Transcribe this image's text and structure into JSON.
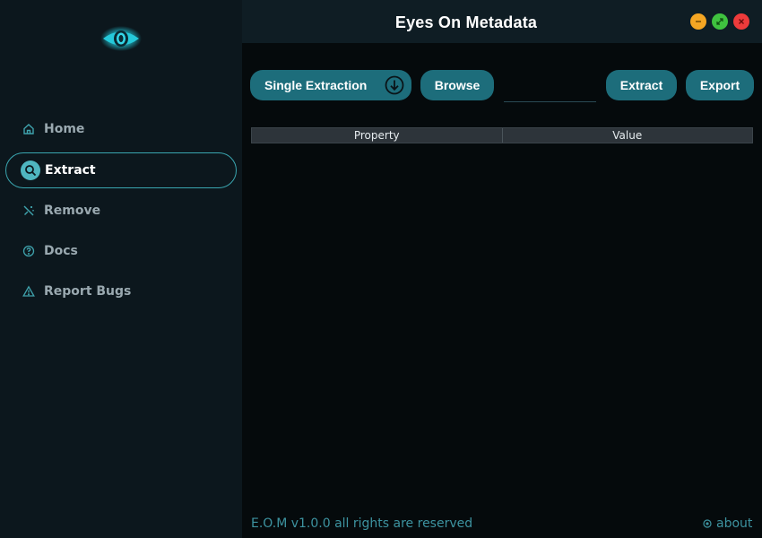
{
  "app": {
    "title": "Eyes On Metadata"
  },
  "sidebar": {
    "items": [
      {
        "label": "Home",
        "icon": "home-icon"
      },
      {
        "label": "Extract",
        "icon": "search-icon",
        "active": true
      },
      {
        "label": "Remove",
        "icon": "magic-wand-off-icon"
      },
      {
        "label": "Docs",
        "icon": "help-circle-icon"
      },
      {
        "label": "Report Bugs",
        "icon": "warning-triangle-icon"
      }
    ]
  },
  "toolbar": {
    "mode_label": "Single Extraction",
    "browse_label": "Browse",
    "path_value": "",
    "extract_label": "Extract",
    "export_label": "Export"
  },
  "table": {
    "columns": [
      "Property",
      "Value"
    ],
    "rows": []
  },
  "footer": {
    "version_text": "E.O.M v1.0.0 all rights are reserved",
    "about_label": "about"
  },
  "colors": {
    "accent": "#1d6d7b",
    "accent_light": "#4fb6c0",
    "sidebar_bg": "#0c171d",
    "header_bg": "#0f1d24",
    "main_bg": "#050a0c",
    "minimize": "#f5a623",
    "maximize": "#3fc23f",
    "close": "#ee3b3b"
  }
}
